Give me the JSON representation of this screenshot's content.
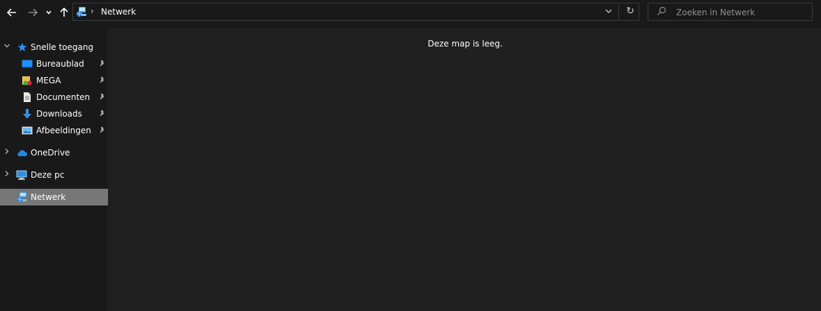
{
  "nav": {
    "back_icon": "arrow-left-icon",
    "forward_icon": "arrow-right-icon",
    "recent_icon": "chevron-down-icon",
    "up_icon": "arrow-up-icon"
  },
  "address": {
    "icon": "network-icon",
    "separator": "›",
    "path": "Netwerk",
    "dropdown_glyph": "⌄",
    "refresh_glyph": "↻"
  },
  "search": {
    "placeholder": "Zoeken in Netwerk",
    "value": ""
  },
  "sidebar": {
    "items": [
      {
        "label": "Snelle toegang",
        "icon": "star-icon",
        "expander": "⌄"
      },
      {
        "label": "Bureaublad",
        "icon": "desktop-icon",
        "pinned": true
      },
      {
        "label": "MEGA",
        "icon": "mega-folder-icon",
        "pinned": true
      },
      {
        "label": "Documenten",
        "icon": "document-icon",
        "pinned": true
      },
      {
        "label": "Downloads",
        "icon": "download-icon",
        "pinned": true
      },
      {
        "label": "Afbeeldingen",
        "icon": "pictures-icon",
        "pinned": true
      },
      {
        "label": "OneDrive",
        "icon": "cloud-icon",
        "expander": "›"
      },
      {
        "label": "Deze pc",
        "icon": "computer-icon",
        "expander": "›"
      },
      {
        "label": "Netwerk",
        "icon": "network-icon",
        "selected": true
      }
    ]
  },
  "content": {
    "empty_message": "Deze map is leeg."
  },
  "colors": {
    "background": "#191919",
    "content_background": "#202020",
    "selection": "#777777",
    "accent_blue": "#1e90ff"
  }
}
